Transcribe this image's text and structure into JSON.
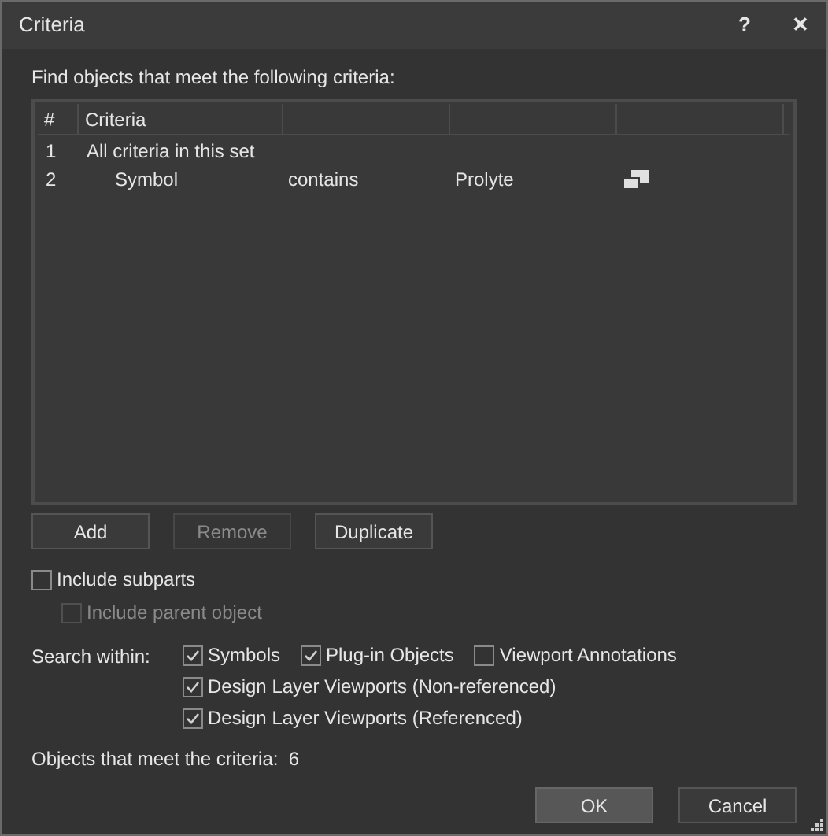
{
  "window": {
    "title": "Criteria",
    "help": "?",
    "close": "✕"
  },
  "prompt": "Find objects that meet the following criteria:",
  "table": {
    "columns": [
      "#",
      "Criteria"
    ],
    "rows": [
      {
        "number": "1",
        "criteria": "All criteria in this set",
        "children": [
          {
            "number": "2",
            "criteria": "Symbol",
            "column_3": "contains",
            "column_4": "Prolyte"
          }
        ]
      }
    ]
  },
  "list_buttons": [
    {
      "label": "Add",
      "disabled": false
    },
    {
      "label": "Remove",
      "disabled": true
    },
    {
      "label": "Duplicate",
      "disabled": false
    }
  ],
  "include_subparts": {
    "label": "Include subparts",
    "checked": false,
    "disabled": false
  },
  "include_parent": {
    "label": "Include parent object",
    "checked": false,
    "disabled": true
  },
  "search_within": {
    "label": "Search within:",
    "options": [
      {
        "label": "Symbols",
        "checked": true
      },
      {
        "label": "Plug-in Objects",
        "checked": true
      },
      {
        "label": "Viewport Annotations",
        "checked": false
      },
      {
        "label": "Design Layer Viewports (Non-referenced)",
        "checked": true
      },
      {
        "label": "Design Layer Viewports (Referenced)",
        "checked": true
      }
    ]
  },
  "result": {
    "label": "Objects that meet the criteria:",
    "count": "6"
  },
  "buttons": [
    {
      "label": "OK",
      "default": true
    },
    {
      "label": "Cancel",
      "default": false
    }
  ]
}
